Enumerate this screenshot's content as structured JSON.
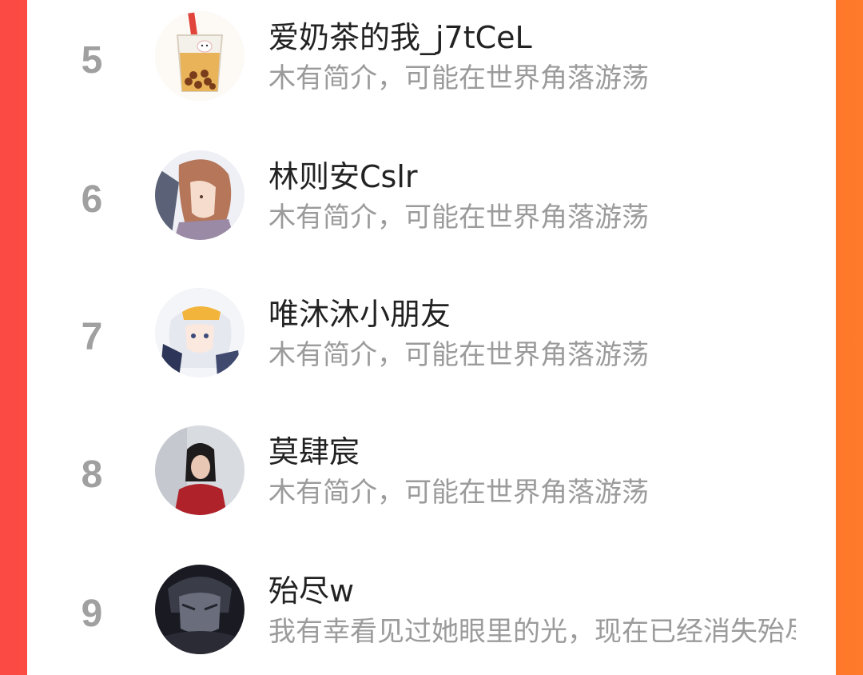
{
  "ranking": {
    "items": [
      {
        "rank": "5",
        "name": "爱奶茶的我_j7tCeL",
        "bio": "木有简介，可能在世界角落游荡",
        "avatar_icon": "milk-tea-icon"
      },
      {
        "rank": "6",
        "name": "林则安Cslr",
        "bio": "木有简介，可能在世界角落游荡",
        "avatar_icon": "anime-girl-brown-hair-avatar"
      },
      {
        "rank": "7",
        "name": "唯沐沐小朋友",
        "bio": "木有简介，可能在世界角落游荡",
        "avatar_icon": "anime-girl-white-hair-avatar"
      },
      {
        "rank": "8",
        "name": "莫肆宸",
        "bio": "木有简介，可能在世界角落游荡",
        "avatar_icon": "photo-girl-red-jacket-avatar"
      },
      {
        "rank": "9",
        "name": "殆尽w",
        "bio": "我有幸看见过她眼里的光，现在已经消失殆尽",
        "avatar_icon": "dark-anime-avatar"
      }
    ]
  },
  "colors": {
    "background_left": "#fb4a43",
    "background_right": "#ff7a2a",
    "rank_color": "#a0a0a0",
    "name_color": "#222222",
    "bio_color": "#9b9b9b"
  }
}
